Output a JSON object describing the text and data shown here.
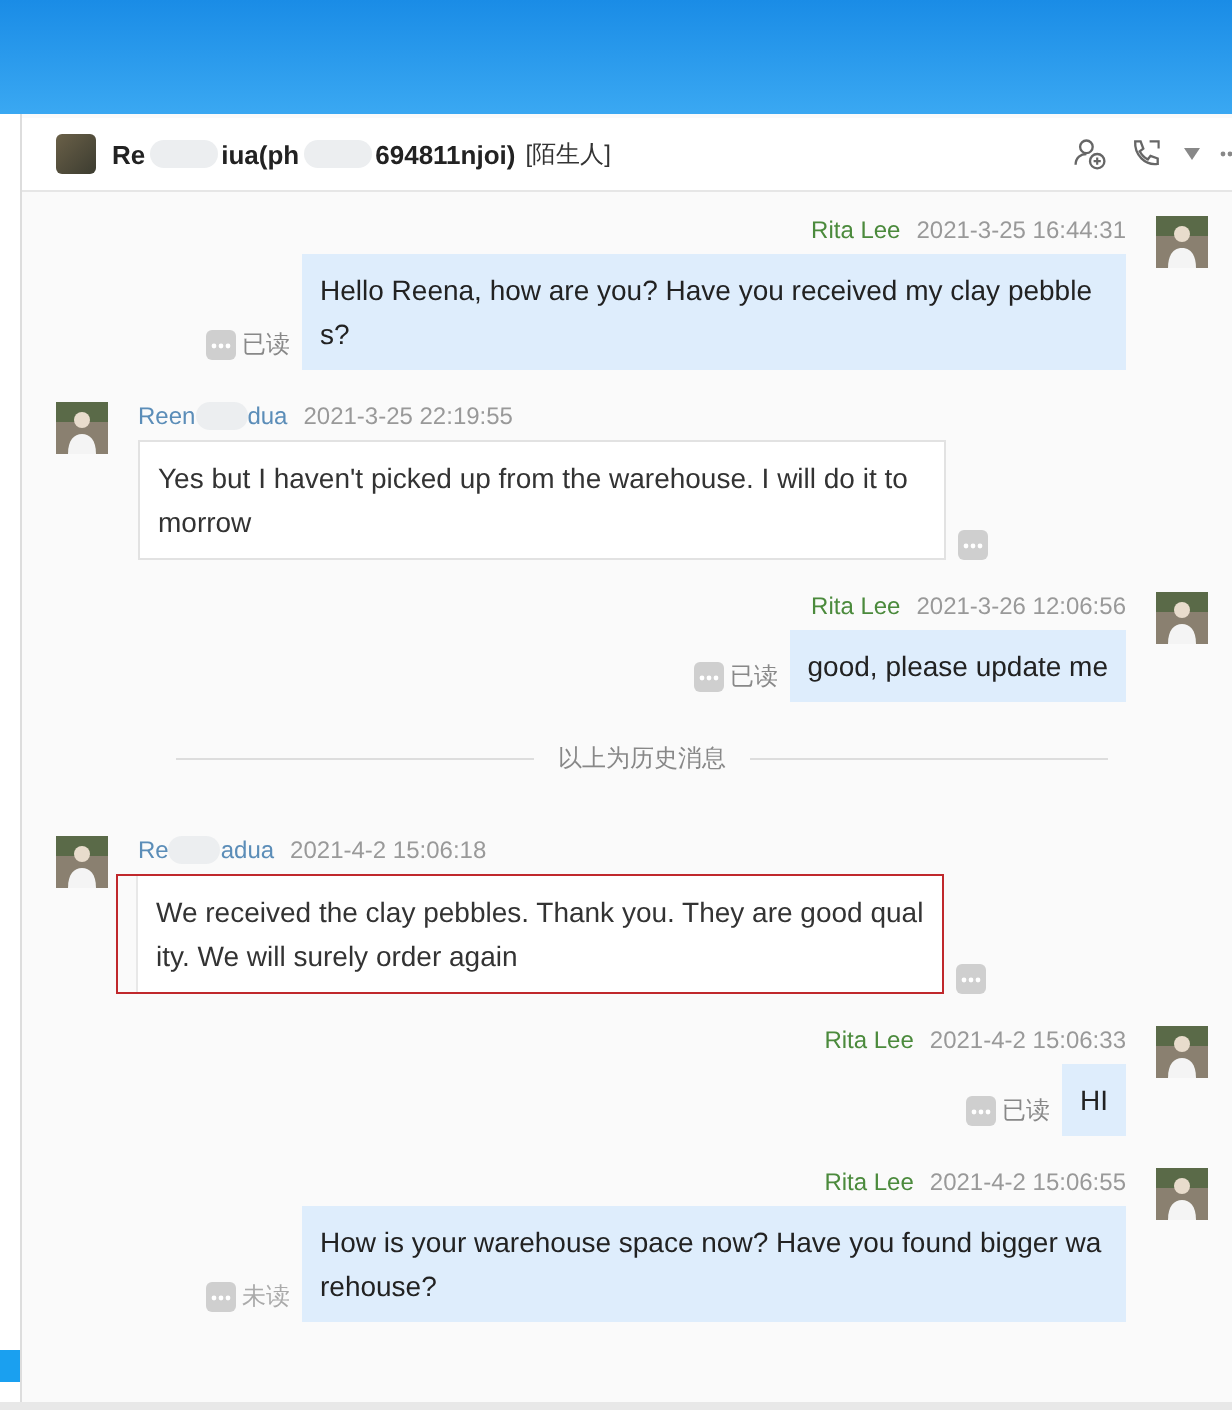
{
  "header": {
    "title_parts": [
      "Re",
      "iua(ph",
      "694811njoi)"
    ],
    "tag": "[陌生人]"
  },
  "messages": [
    {
      "kind": "sent",
      "sender_parts": [
        "Rita Lee"
      ],
      "time": "2021-3-25 16:44:31",
      "text": "Hello Reena, how are you? Have you received my clay pebbles?",
      "status": "已读",
      "read": true
    },
    {
      "kind": "received",
      "sender_parts": [
        "Reen",
        "dua"
      ],
      "time": "2021-3-25 22:19:55",
      "text": "Yes but I haven't picked up from the warehouse. I will do it tomorrow",
      "highlighted": false
    },
    {
      "kind": "sent",
      "sender_parts": [
        "Rita Lee"
      ],
      "time": "2021-3-26 12:06:56",
      "text": "good, please update me",
      "status": "已读",
      "read": true
    },
    {
      "kind": "divider",
      "text": "以上为历史消息"
    },
    {
      "kind": "received",
      "sender_parts": [
        "Re",
        "adua"
      ],
      "time": "2021-4-2 15:06:18",
      "text": "We received the clay pebbles. Thank you. They are good quality. We will surely order again",
      "highlighted": true
    },
    {
      "kind": "sent",
      "sender_parts": [
        "Rita Lee"
      ],
      "time": "2021-4-2 15:06:33",
      "text": "HI",
      "status": "已读",
      "read": true
    },
    {
      "kind": "sent",
      "sender_parts": [
        "Rita Lee"
      ],
      "time": "2021-4-2 15:06:55",
      "text": "How is your warehouse space now? Have you found bigger warehouse?",
      "status": "未读",
      "read": false
    }
  ]
}
